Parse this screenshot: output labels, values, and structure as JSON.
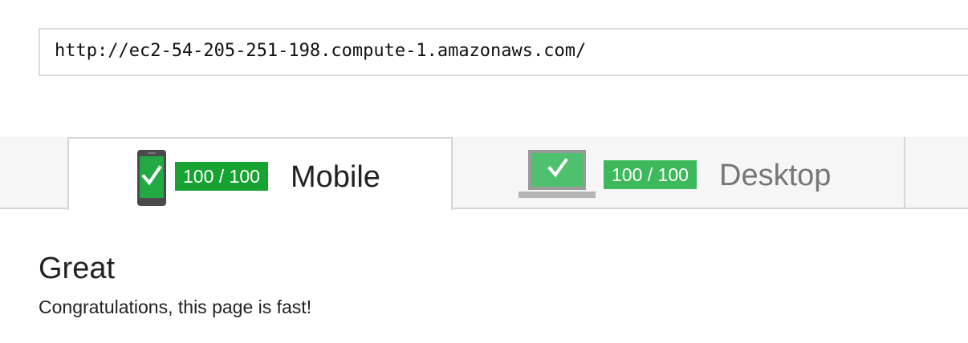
{
  "url_field": {
    "value": "http://ec2-54-205-251-198.compute-1.amazonaws.com/"
  },
  "tabs": [
    {
      "id": "mobile",
      "icon": "phone-icon",
      "score": "100 / 100",
      "label": "Mobile",
      "selected": true
    },
    {
      "id": "desktop",
      "icon": "laptop-icon",
      "score": "100 / 100",
      "label": "Desktop",
      "selected": false
    }
  ],
  "result": {
    "heading": "Great",
    "message": "Congratulations, this page is fast!"
  },
  "colors": {
    "score_green_active": "#17a232",
    "score_green_inactive": "#3db85a",
    "icon_green": "#22a943",
    "device_gray": "#5a5a5a"
  }
}
